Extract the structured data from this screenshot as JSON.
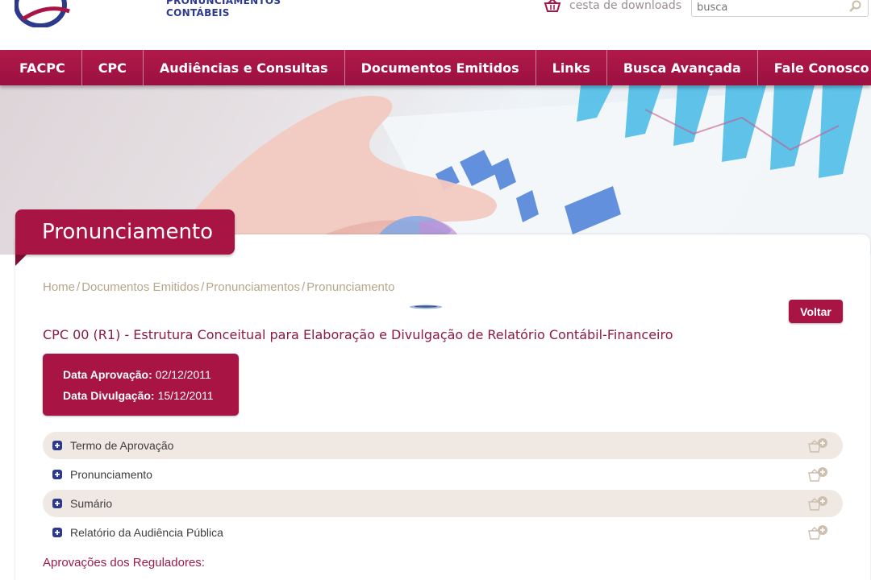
{
  "header": {
    "logo_text_line1": "PRONUNCIAMENTOS",
    "logo_text_line2": "CONTÁBEIS",
    "cart_label": "cesta de downloads",
    "search_placeholder": "busca"
  },
  "nav": {
    "items": [
      "FACPC",
      "CPC",
      "Audiências e Consultas",
      "Documentos Emitidos",
      "Links",
      "Busca Avançada",
      "Fale Conosco"
    ]
  },
  "section": {
    "title": "Pronunciamento"
  },
  "breadcrumb": [
    "Home",
    "Documentos Emitidos",
    "Pronunciamentos",
    "Pronunciamento"
  ],
  "back_button": "Voltar",
  "document": {
    "title": "CPC 00 (R1) - Estrutura Conceitual para Elaboração e Divulgação de Relatório Contábil-Financeiro",
    "approval_label": "Data Aprovação:",
    "approval_date": "02/12/2011",
    "release_label": "Data Divulgação:",
    "release_date": "15/12/2011"
  },
  "docs": [
    {
      "label": "Termo de Aprovação",
      "icon": "plus-icon",
      "cart_icon": "add-to-basket-icon"
    },
    {
      "label": "Pronunciamento",
      "icon": "plus-icon",
      "cart_icon": "add-to-basket-icon"
    },
    {
      "label": "Sumário",
      "icon": "plus-icon",
      "cart_icon": "add-to-basket-icon"
    },
    {
      "label": "Relatório da Audiência Pública",
      "icon": "plus-icon",
      "cart_icon": "add-to-basket-icon"
    }
  ],
  "regulators_heading": "Aprovações dos Reguladores:",
  "colors": {
    "brand": "#a81444",
    "breadcrumb": "#b8a68a",
    "row_shade": "#f0e8e3",
    "logo_blue": "#2d3a8c"
  }
}
